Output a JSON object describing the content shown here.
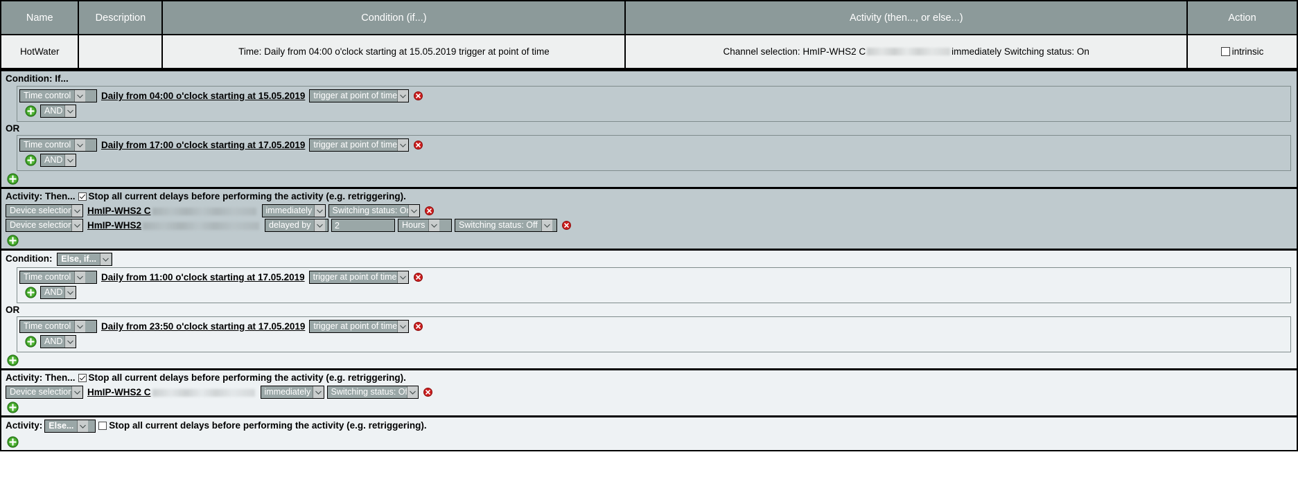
{
  "summary": {
    "columns": [
      "Name",
      "Description",
      "Condition (if...)",
      "Activity (then..., or else...)",
      "Action"
    ],
    "row": {
      "name": "HotWater",
      "description": "",
      "condition": "Time: Daily from 04:00 o'clock starting at 15.05.2019 trigger at point of time",
      "activity_prefix": "Channel selection: HmIP-WHS2 C",
      "activity_suffix": "immediately Switching status: On",
      "action_label": "intrinsic",
      "action_checked": false
    }
  },
  "icons": {
    "add": "add-icon",
    "delete": "delete-icon",
    "dropdown_arrow": "chevron-down-icon",
    "checkbox": "checkbox-icon"
  },
  "colors": {
    "header_bg": "#8c9a9a",
    "row_bg": "#eef0f0",
    "block_dark": "#bfcace",
    "block_light": "#eef2f4",
    "select_bg": "#9aa7a7",
    "select_arrow_bg": "#c9cdcd",
    "border": "#000000",
    "add_icon": "#3f9f27",
    "delete_icon": "#cc1e1e"
  },
  "blocks": [
    {
      "id": "condition-if",
      "label": "Condition: If...",
      "theme": "dark",
      "groups": [
        {
          "rows": [
            {
              "type": "time",
              "source_select": "Time control",
              "link": "Daily from 04:00 o'clock starting at 15.05.2019",
              "trigger_select": "trigger at point of time"
            }
          ],
          "add_label": "",
          "operator_select": "AND"
        },
        {
          "separator": "OR",
          "rows": [
            {
              "type": "time",
              "source_select": "Time control",
              "link": "Daily from 17:00 o'clock starting at 17.05.2019",
              "trigger_select": "trigger at point of time"
            }
          ],
          "operator_select": "AND"
        }
      ]
    },
    {
      "id": "activity-then-1",
      "label": "Activity: Then...",
      "stop_delays_label": "Stop all current delays before performing the activity (e.g. retriggering).",
      "stop_delays_checked": true,
      "theme": "dark",
      "rows": [
        {
          "device_select": "Device selection",
          "device_link": "HmIP-WHS2 C",
          "timing_select": "immediately",
          "delay_value": "",
          "delay_unit": "",
          "status_select": "Switching status: On"
        },
        {
          "device_select": "Device selection",
          "device_link": "HmIP-WHS2",
          "timing_select": "delayed by",
          "delay_value": "2",
          "delay_unit": "Hours",
          "status_select": "Switching status: Off"
        }
      ]
    },
    {
      "id": "condition-else-if",
      "label": "Condition:",
      "mode_select": "Else, if...",
      "theme": "light",
      "groups": [
        {
          "rows": [
            {
              "type": "time",
              "source_select": "Time control",
              "link": "Daily from 11:00 o'clock starting at 17.05.2019",
              "trigger_select": "trigger at point of time"
            }
          ],
          "operator_select": "AND"
        },
        {
          "separator": "OR",
          "rows": [
            {
              "type": "time",
              "source_select": "Time control",
              "link": "Daily from 23:50 o'clock starting at 17.05.2019",
              "trigger_select": "trigger at point of time"
            }
          ],
          "operator_select": "AND"
        }
      ]
    },
    {
      "id": "activity-then-2",
      "label": "Activity: Then...",
      "stop_delays_label": "Stop all current delays before performing the activity (e.g. retriggering).",
      "stop_delays_checked": true,
      "theme": "light",
      "rows": [
        {
          "device_select": "Device selection",
          "device_link": "HmIP-WHS2 C",
          "timing_select": "immediately",
          "status_select": "Switching status: Off"
        }
      ]
    },
    {
      "id": "activity-else",
      "label": "Activity:",
      "mode_select": "Else...",
      "stop_delays_label": "Stop all current delays before performing the activity (e.g. retriggering).",
      "stop_delays_checked": false,
      "theme": "light",
      "rows": []
    }
  ]
}
